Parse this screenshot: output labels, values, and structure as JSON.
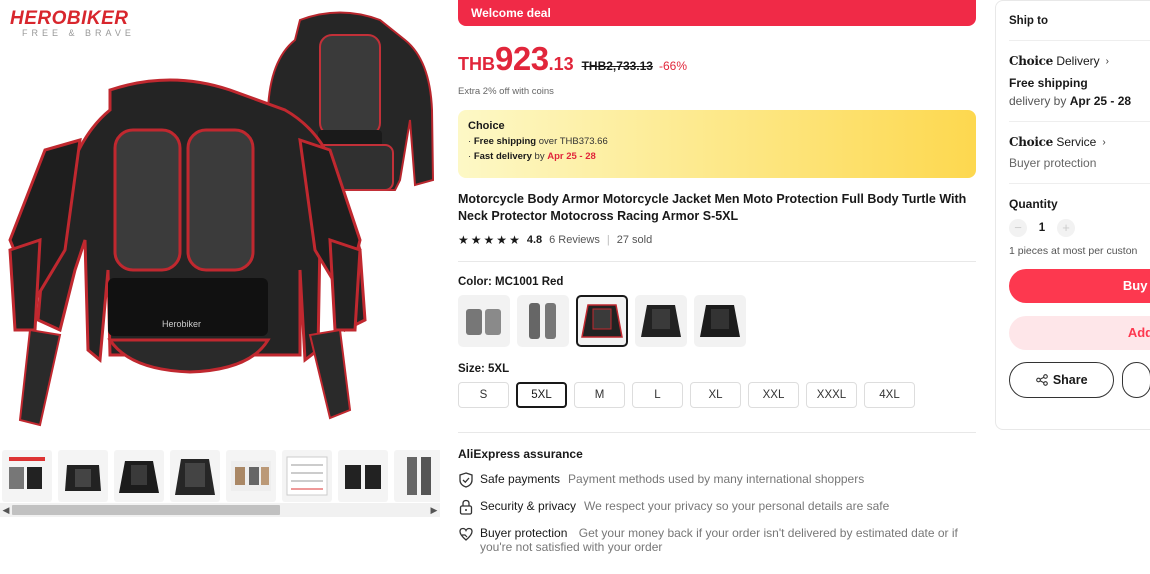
{
  "gallery": {
    "brand": {
      "name": "HEROBIKER",
      "tagline": "FREE & BRAVE"
    },
    "thumbnail_count": 9,
    "scroll_left": "◀",
    "scroll_right": "▶"
  },
  "deal": {
    "label": "Welcome deal"
  },
  "price": {
    "currency": "THB",
    "integer": "923",
    "decimal": ".13",
    "original": "THB2,733.13",
    "discount": "-66%",
    "coins_note": "Extra 2% off with coins"
  },
  "choice": {
    "title": "Choice",
    "free_shipping_label": "Free shipping",
    "free_shipping_rest": " over THB373.66",
    "fast_delivery_label": "Fast delivery",
    "fast_delivery_mid": " by ",
    "fast_delivery_dates": "Apr 25 - 28",
    "bullet": "· "
  },
  "product": {
    "title": "Motorcycle Body Armor Motorcycle Jacket Men Moto Protection Full Body Turtle With Neck Protector Motocross Racing Armor S-5XL",
    "rating": "4.8",
    "reviews": "6 Reviews",
    "separator": "|",
    "sold": "27 sold"
  },
  "color": {
    "label": "Color: MC1001 Red",
    "selected_index": 2,
    "options": [
      "shorts-gray",
      "pants-gray",
      "jacket-red",
      "jacket-black",
      "jacket-black-2"
    ]
  },
  "size": {
    "label": "Size: 5XL",
    "options": [
      "S",
      "5XL",
      "M",
      "L",
      "XL",
      "XXL",
      "XXXL",
      "4XL"
    ],
    "selected": "5XL"
  },
  "assurance": {
    "title": "AliExpress assurance",
    "items": [
      {
        "name": "Safe payments",
        "desc": "Payment methods used by many international shoppers",
        "icon": "shield-check-icon"
      },
      {
        "name": "Security & privacy",
        "desc": "We respect your privacy so your personal details are safe",
        "icon": "lock-icon"
      },
      {
        "name": "Buyer protection",
        "desc": "Get your money back if your order isn't delivered by estimated date or if you're not satisfied with your order",
        "icon": "heart-hand-icon"
      }
    ]
  },
  "side": {
    "ship_to": "Ship to",
    "delivery": {
      "choice_word": "Choice",
      "label": "Delivery",
      "free_shipping": "Free shipping",
      "delivery_by": "delivery by ",
      "dates": "Apr 25 - 28"
    },
    "service": {
      "choice_word": "Choice",
      "label": "Service",
      "buyer_protection": "Buyer protection"
    },
    "quantity": {
      "label": "Quantity",
      "value": "1",
      "minus": "−",
      "plus": "+",
      "note": "1 pieces at most per custon"
    },
    "buy_label": "Buy n",
    "add_label": "Add to",
    "share_label": "Share"
  },
  "colors": {
    "accent": "#fd384f",
    "deal": "#f02a47",
    "price": "#e1263b"
  }
}
